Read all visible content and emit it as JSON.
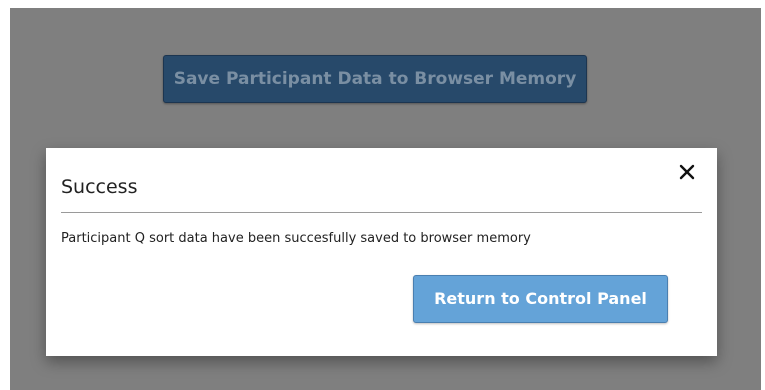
{
  "background": {
    "save_button_label": "Save Participant Data to Browser Memory"
  },
  "modal": {
    "title": "Success",
    "close_icon": "close-icon",
    "message": "Participant Q sort data have been succesfully saved to browser memory",
    "return_button_label": "Return to Control Panel"
  },
  "colors": {
    "overlay": "#7f7f7f",
    "save_button": "#27496a",
    "return_button": "#64a3d8",
    "modal_background": "#ffffff"
  }
}
